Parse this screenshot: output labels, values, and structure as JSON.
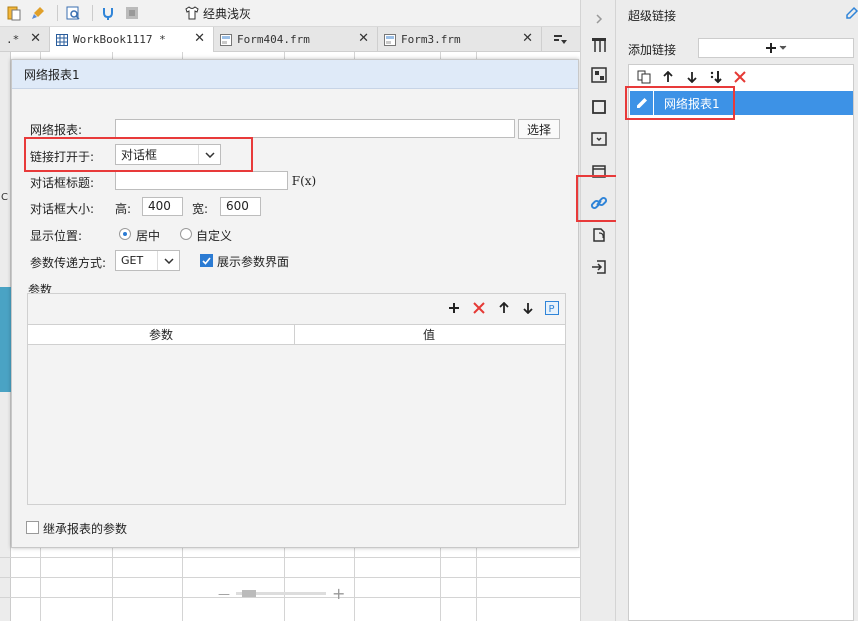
{
  "toolbar": {
    "theme_label": "经典浅灰"
  },
  "tabs": [
    {
      "label": ".*",
      "active": false
    },
    {
      "label": "WorkBook1117 *",
      "active": true
    },
    {
      "label": "Form404.frm",
      "active": false
    },
    {
      "label": "Form3.frm",
      "active": false
    }
  ],
  "sheet": {
    "cell_fragment": "C"
  },
  "dialog": {
    "title": "网络报表1",
    "report_label": "网络报表:",
    "report_value": "",
    "select_button": "选择",
    "open_in_label": "链接打开于:",
    "open_in_value": "对话框",
    "dialog_title_label": "对话框标题:",
    "dialog_title_value": "",
    "formula_button": "F(x)",
    "size_label": "对话框大小:",
    "height_label": "高:",
    "height_value": "400",
    "width_label": "宽:",
    "width_value": "600",
    "position_label": "显示位置:",
    "position_options": [
      {
        "label": "居中",
        "selected": true
      },
      {
        "label": "自定义",
        "selected": false
      }
    ],
    "method_label": "参数传递方式:",
    "method_value": "GET",
    "show_params_label": "展示参数界面",
    "show_params_checked": true,
    "params_section_label": "参数",
    "params_columns": [
      "参数",
      "值"
    ],
    "params_rows": [],
    "inherit_label": "继承报表的参数",
    "inherit_checked": false
  },
  "panel": {
    "title": "超级链接",
    "add_link_label": "添加链接",
    "links": [
      {
        "label": "网络报表1",
        "selected": true
      }
    ]
  },
  "colors": {
    "accent": "#3d92e6",
    "highlight": "#e83a3a",
    "delete": "#e53935"
  }
}
